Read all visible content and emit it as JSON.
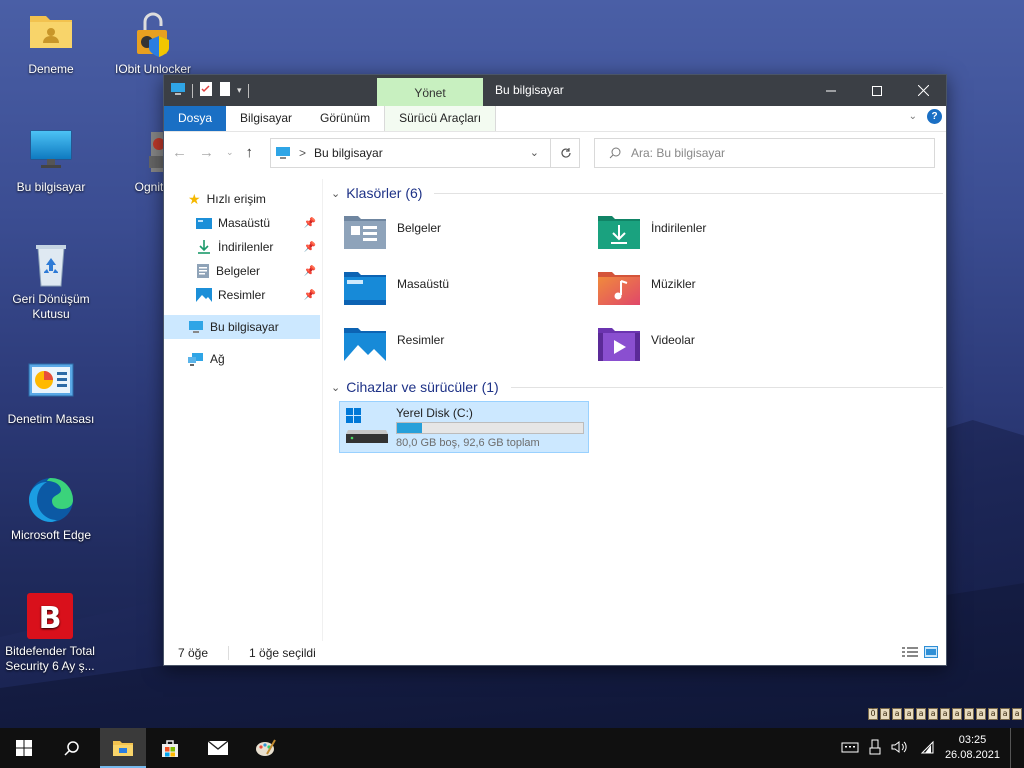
{
  "desktop": {
    "icons": [
      {
        "label": "Deneme"
      },
      {
        "label": "IObit Unlocker"
      },
      {
        "label": "Bu bilgisayar"
      },
      {
        "label": "Ognitor"
      },
      {
        "label": "Geri Dönüşüm Kutusu"
      },
      {
        "label": "Denetim Masası"
      },
      {
        "label": "Microsoft Edge"
      },
      {
        "label": "Bitdefender Total Security  6 Ay ş..."
      }
    ],
    "watermark": "Öaaaaaaaaaaaaö"
  },
  "window": {
    "title": "Bu bilgisayar",
    "context_tab_group": "Yönet",
    "tabs": [
      "Dosya",
      "Bilgisayar",
      "Görünüm",
      "Sürücü Araçları"
    ],
    "help": "?",
    "address": {
      "path_label": "Bu bilgisayar",
      "separator": ">"
    },
    "search": {
      "placeholder": "Ara: Bu bilgisayar"
    },
    "nav_pane": {
      "quick_access": "Hızlı erişim",
      "quick_items": [
        "Masaüstü",
        "İndirilenler",
        "Belgeler",
        "Resimler"
      ],
      "this_pc": "Bu bilgisayar",
      "network": "Ağ"
    },
    "folders_header": "Klasörler (6)",
    "folders": [
      "Belgeler",
      "İndirilenler",
      "Masaüstü",
      "Müzikler",
      "Resimler",
      "Videolar"
    ],
    "devices_header": "Cihazlar ve sürücüler (1)",
    "drive": {
      "name": "Yerel Disk (C:)",
      "info": "80,0 GB boş, 92,6 GB toplam",
      "used_fraction": 0.136
    },
    "status": {
      "items": "7 öğe",
      "selected": "1 öğe seçildi"
    }
  },
  "taskbar": {
    "time": "03:25",
    "date": "26.08.2021"
  }
}
